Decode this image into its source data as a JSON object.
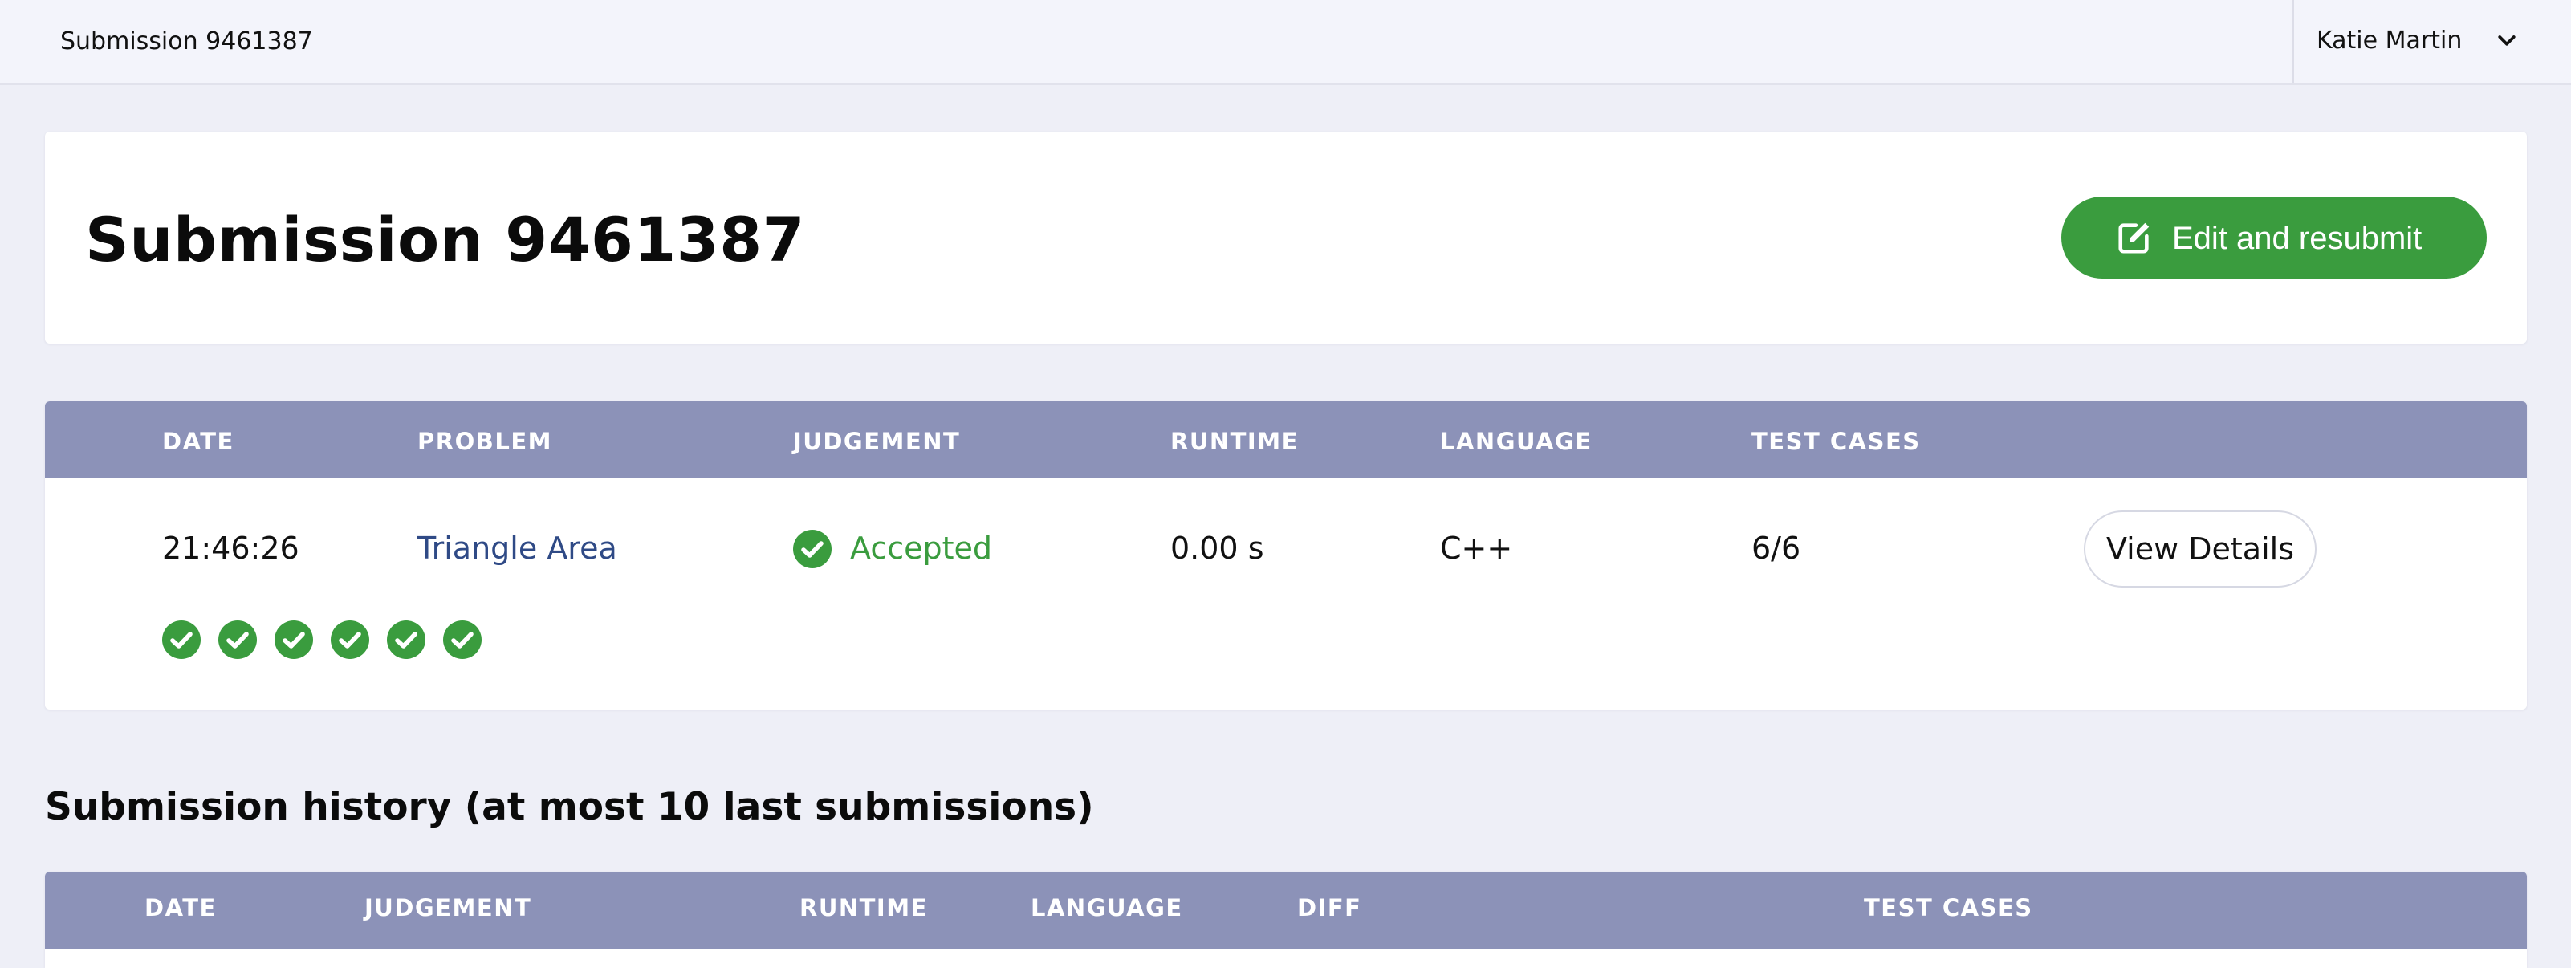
{
  "topbar": {
    "title": "Submission 9461387",
    "user_name": "Katie Martin"
  },
  "header": {
    "title": "Submission 9461387",
    "resubmit_label": "Edit and resubmit"
  },
  "submission": {
    "columns": [
      "DATE",
      "PROBLEM",
      "JUDGEMENT",
      "RUNTIME",
      "LANGUAGE",
      "TEST CASES"
    ],
    "row": {
      "date": "21:46:26",
      "problem": "Triangle Area",
      "judgement": "Accepted",
      "runtime": "0.00 s",
      "language": "C++",
      "test_cases": "6/6"
    },
    "details_label": "View Details",
    "test_case_results": [
      "passed",
      "passed",
      "passed",
      "passed",
      "passed",
      "passed"
    ]
  },
  "history": {
    "title": "Submission history (at most 10 last submissions)",
    "columns": [
      "DATE",
      "JUDGEMENT",
      "RUNTIME",
      "LANGUAGE",
      "DIFF",
      "TEST CASES"
    ]
  },
  "colors": {
    "accent_green": "#3a9c3e",
    "table_header": "#8c92b8",
    "link": "#2f4a86",
    "background": "#eeeff7"
  },
  "icons": {
    "user_menu": "chevron-down-icon",
    "resubmit": "edit-icon",
    "judgement": "check-circle-icon",
    "test_case": "check-circle-icon"
  }
}
